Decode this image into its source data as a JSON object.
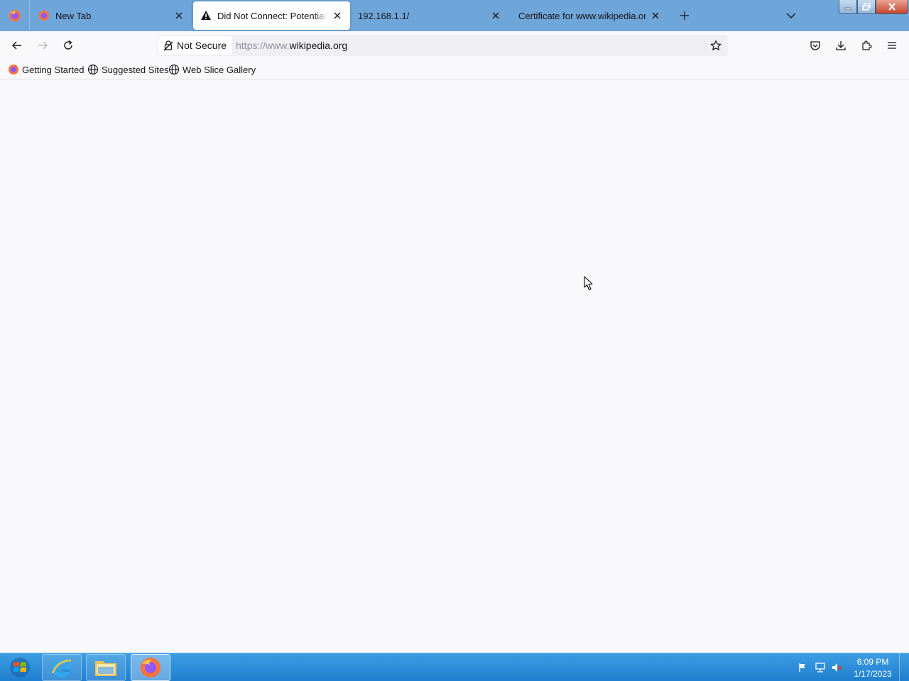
{
  "browser": {
    "tabs": [
      {
        "label": "New Tab",
        "active": false
      },
      {
        "label": "Did Not Connect: Potential Security Issue",
        "active": true
      },
      {
        "label": "192.168.1.1/",
        "active": false
      },
      {
        "label": "Certificate for www.wikipedia.org",
        "active": false
      }
    ],
    "urlbar": {
      "security_label": "Not Secure",
      "url_prefix": "https://www.",
      "url_domain": "wikipedia.org"
    },
    "bookmarks": [
      {
        "label": "Getting Started",
        "icon": "firefox-icon"
      },
      {
        "label": "Suggested Sites",
        "icon": "globe-icon"
      },
      {
        "label": "Web Slice Gallery",
        "icon": "globe-icon"
      }
    ]
  },
  "taskbar": {
    "apps": [
      {
        "name": "internet-explorer",
        "icon": "ie-icon"
      },
      {
        "name": "file-explorer",
        "icon": "folder-icon"
      },
      {
        "name": "firefox",
        "icon": "firefox-icon",
        "active": true
      }
    ],
    "clock": {
      "time": "6:09 PM",
      "date": "1/17/2023"
    }
  },
  "colors": {
    "tabbar": "#6fa6d9",
    "taskbar": "#2a8bd8",
    "content_bg": "#f9f9fb"
  }
}
